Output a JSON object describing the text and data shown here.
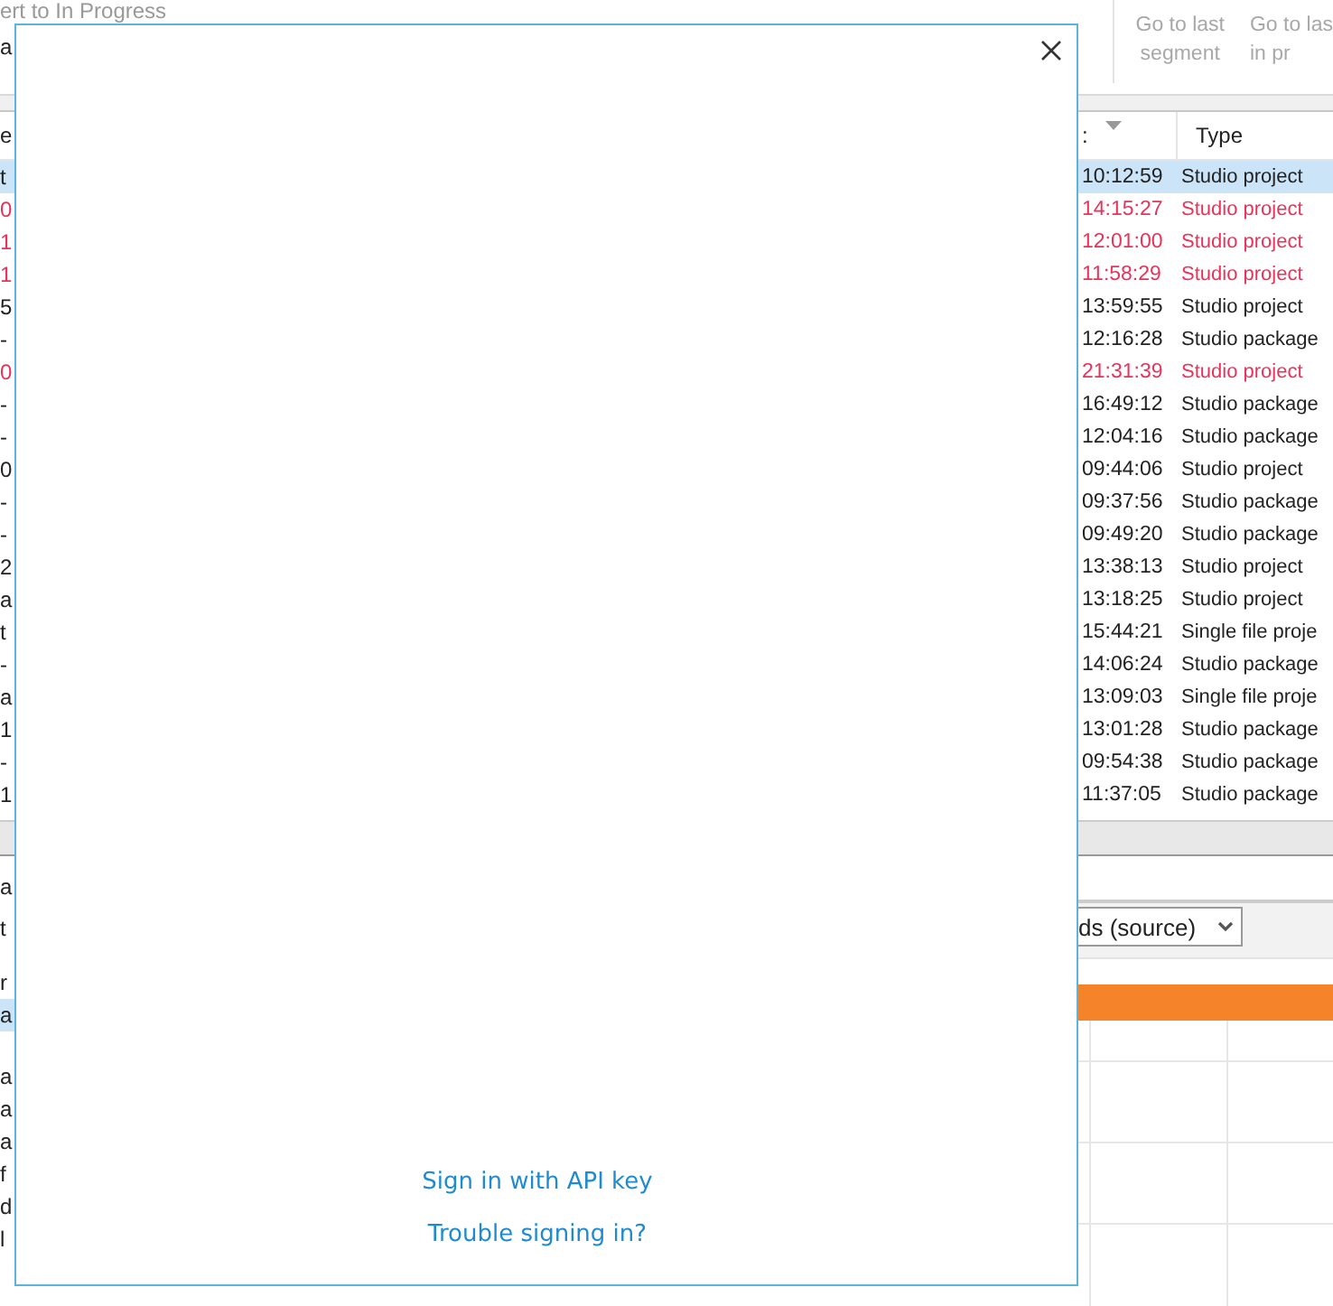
{
  "ribbon": {
    "left_lines": [
      "ert to In Progress",
      "a"
    ],
    "buttons": [
      {
        "lines": [
          "Go to last",
          "segment"
        ]
      },
      {
        "lines": [
          "Go to las",
          "in pr"
        ]
      }
    ]
  },
  "table": {
    "columns": [
      {
        "label": "e"
      },
      {
        "label": ":"
      },
      {
        "label": "Type"
      }
    ],
    "rows": [
      {
        "column_1": "t",
        "column_2": "10:12:59",
        "type": "Studio project",
        "selected": true,
        "flagged": false
      },
      {
        "column_1": "0",
        "column_2": "14:15:27",
        "type": "Studio project",
        "selected": false,
        "flagged": true
      },
      {
        "column_1": "1",
        "column_2": "12:01:00",
        "type": "Studio project",
        "selected": false,
        "flagged": true
      },
      {
        "column_1": "1",
        "column_2": "11:58:29",
        "type": "Studio project",
        "selected": false,
        "flagged": true
      },
      {
        "column_1": "5",
        "column_2": "13:59:55",
        "type": "Studio project",
        "selected": false,
        "flagged": false
      },
      {
        "column_1": "-",
        "column_2": "12:16:28",
        "type": "Studio package",
        "selected": false,
        "flagged": false
      },
      {
        "column_1": "0",
        "column_2": "21:31:39",
        "type": "Studio project",
        "selected": false,
        "flagged": true
      },
      {
        "column_1": "-",
        "column_2": "16:49:12",
        "type": "Studio package",
        "selected": false,
        "flagged": false
      },
      {
        "column_1": "-",
        "column_2": "12:04:16",
        "type": "Studio package",
        "selected": false,
        "flagged": false
      },
      {
        "column_1": "0",
        "column_2": "09:44:06",
        "type": "Studio project",
        "selected": false,
        "flagged": false
      },
      {
        "column_1": "-",
        "column_2": "09:37:56",
        "type": "Studio package",
        "selected": false,
        "flagged": false
      },
      {
        "column_1": "-",
        "column_2": "09:49:20",
        "type": "Studio package",
        "selected": false,
        "flagged": false
      },
      {
        "column_1": "2",
        "column_2": "13:38:13",
        "type": "Studio project",
        "selected": false,
        "flagged": false
      },
      {
        "column_1": "a",
        "column_2": "13:18:25",
        "type": "Studio project",
        "selected": false,
        "flagged": false
      },
      {
        "column_1": "t",
        "column_2": "15:44:21",
        "type": "Single file proje",
        "selected": false,
        "flagged": false
      },
      {
        "column_1": "-",
        "column_2": "14:06:24",
        "type": "Studio package",
        "selected": false,
        "flagged": false
      },
      {
        "column_1": "a",
        "column_2": "13:09:03",
        "type": "Single file proje",
        "selected": false,
        "flagged": false
      },
      {
        "column_1": "1",
        "column_2": "13:01:28",
        "type": "Studio package",
        "selected": false,
        "flagged": false
      },
      {
        "column_1": "-",
        "column_2": "09:54:38",
        "type": "Studio package",
        "selected": false,
        "flagged": false
      },
      {
        "column_1": "1",
        "column_2": "11:37:05",
        "type": "Studio package",
        "selected": false,
        "flagged": false
      }
    ]
  },
  "lower_panel": {
    "left_items": [
      {
        "text": "a",
        "selected": false
      },
      {
        "text": "t",
        "selected": false
      },
      {
        "text": "r",
        "selected": false
      },
      {
        "text": "a",
        "selected": true
      },
      {
        "text": "a",
        "selected": false
      },
      {
        "text": "a",
        "selected": false
      },
      {
        "text": "a",
        "selected": false
      },
      {
        "text": "f",
        "selected": false
      },
      {
        "text": "d",
        "selected": false
      },
      {
        "text": "l",
        "selected": false
      }
    ],
    "dropdown": {
      "value": "ds (source)"
    }
  },
  "dialog": {
    "links": [
      "Sign in with API key",
      "Trouble signing in?"
    ]
  }
}
